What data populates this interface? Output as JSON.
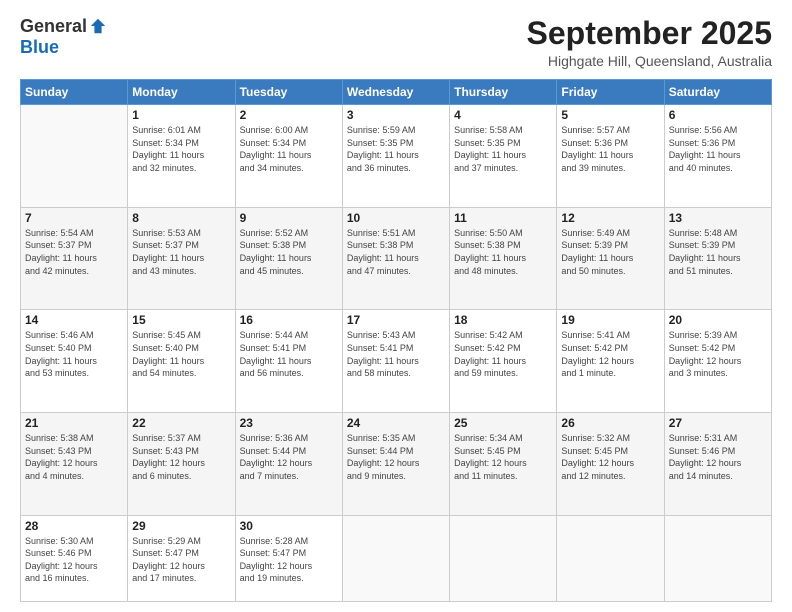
{
  "header": {
    "logo_general": "General",
    "logo_blue": "Blue",
    "month_title": "September 2025",
    "location": "Highgate Hill, Queensland, Australia"
  },
  "days_of_week": [
    "Sunday",
    "Monday",
    "Tuesday",
    "Wednesday",
    "Thursday",
    "Friday",
    "Saturday"
  ],
  "weeks": [
    [
      {
        "day": "",
        "info": ""
      },
      {
        "day": "1",
        "info": "Sunrise: 6:01 AM\nSunset: 5:34 PM\nDaylight: 11 hours\nand 32 minutes."
      },
      {
        "day": "2",
        "info": "Sunrise: 6:00 AM\nSunset: 5:34 PM\nDaylight: 11 hours\nand 34 minutes."
      },
      {
        "day": "3",
        "info": "Sunrise: 5:59 AM\nSunset: 5:35 PM\nDaylight: 11 hours\nand 36 minutes."
      },
      {
        "day": "4",
        "info": "Sunrise: 5:58 AM\nSunset: 5:35 PM\nDaylight: 11 hours\nand 37 minutes."
      },
      {
        "day": "5",
        "info": "Sunrise: 5:57 AM\nSunset: 5:36 PM\nDaylight: 11 hours\nand 39 minutes."
      },
      {
        "day": "6",
        "info": "Sunrise: 5:56 AM\nSunset: 5:36 PM\nDaylight: 11 hours\nand 40 minutes."
      }
    ],
    [
      {
        "day": "7",
        "info": "Sunrise: 5:54 AM\nSunset: 5:37 PM\nDaylight: 11 hours\nand 42 minutes."
      },
      {
        "day": "8",
        "info": "Sunrise: 5:53 AM\nSunset: 5:37 PM\nDaylight: 11 hours\nand 43 minutes."
      },
      {
        "day": "9",
        "info": "Sunrise: 5:52 AM\nSunset: 5:38 PM\nDaylight: 11 hours\nand 45 minutes."
      },
      {
        "day": "10",
        "info": "Sunrise: 5:51 AM\nSunset: 5:38 PM\nDaylight: 11 hours\nand 47 minutes."
      },
      {
        "day": "11",
        "info": "Sunrise: 5:50 AM\nSunset: 5:38 PM\nDaylight: 11 hours\nand 48 minutes."
      },
      {
        "day": "12",
        "info": "Sunrise: 5:49 AM\nSunset: 5:39 PM\nDaylight: 11 hours\nand 50 minutes."
      },
      {
        "day": "13",
        "info": "Sunrise: 5:48 AM\nSunset: 5:39 PM\nDaylight: 11 hours\nand 51 minutes."
      }
    ],
    [
      {
        "day": "14",
        "info": "Sunrise: 5:46 AM\nSunset: 5:40 PM\nDaylight: 11 hours\nand 53 minutes."
      },
      {
        "day": "15",
        "info": "Sunrise: 5:45 AM\nSunset: 5:40 PM\nDaylight: 11 hours\nand 54 minutes."
      },
      {
        "day": "16",
        "info": "Sunrise: 5:44 AM\nSunset: 5:41 PM\nDaylight: 11 hours\nand 56 minutes."
      },
      {
        "day": "17",
        "info": "Sunrise: 5:43 AM\nSunset: 5:41 PM\nDaylight: 11 hours\nand 58 minutes."
      },
      {
        "day": "18",
        "info": "Sunrise: 5:42 AM\nSunset: 5:42 PM\nDaylight: 11 hours\nand 59 minutes."
      },
      {
        "day": "19",
        "info": "Sunrise: 5:41 AM\nSunset: 5:42 PM\nDaylight: 12 hours\nand 1 minute."
      },
      {
        "day": "20",
        "info": "Sunrise: 5:39 AM\nSunset: 5:42 PM\nDaylight: 12 hours\nand 3 minutes."
      }
    ],
    [
      {
        "day": "21",
        "info": "Sunrise: 5:38 AM\nSunset: 5:43 PM\nDaylight: 12 hours\nand 4 minutes."
      },
      {
        "day": "22",
        "info": "Sunrise: 5:37 AM\nSunset: 5:43 PM\nDaylight: 12 hours\nand 6 minutes."
      },
      {
        "day": "23",
        "info": "Sunrise: 5:36 AM\nSunset: 5:44 PM\nDaylight: 12 hours\nand 7 minutes."
      },
      {
        "day": "24",
        "info": "Sunrise: 5:35 AM\nSunset: 5:44 PM\nDaylight: 12 hours\nand 9 minutes."
      },
      {
        "day": "25",
        "info": "Sunrise: 5:34 AM\nSunset: 5:45 PM\nDaylight: 12 hours\nand 11 minutes."
      },
      {
        "day": "26",
        "info": "Sunrise: 5:32 AM\nSunset: 5:45 PM\nDaylight: 12 hours\nand 12 minutes."
      },
      {
        "day": "27",
        "info": "Sunrise: 5:31 AM\nSunset: 5:46 PM\nDaylight: 12 hours\nand 14 minutes."
      }
    ],
    [
      {
        "day": "28",
        "info": "Sunrise: 5:30 AM\nSunset: 5:46 PM\nDaylight: 12 hours\nand 16 minutes."
      },
      {
        "day": "29",
        "info": "Sunrise: 5:29 AM\nSunset: 5:47 PM\nDaylight: 12 hours\nand 17 minutes."
      },
      {
        "day": "30",
        "info": "Sunrise: 5:28 AM\nSunset: 5:47 PM\nDaylight: 12 hours\nand 19 minutes."
      },
      {
        "day": "",
        "info": ""
      },
      {
        "day": "",
        "info": ""
      },
      {
        "day": "",
        "info": ""
      },
      {
        "day": "",
        "info": ""
      }
    ]
  ]
}
